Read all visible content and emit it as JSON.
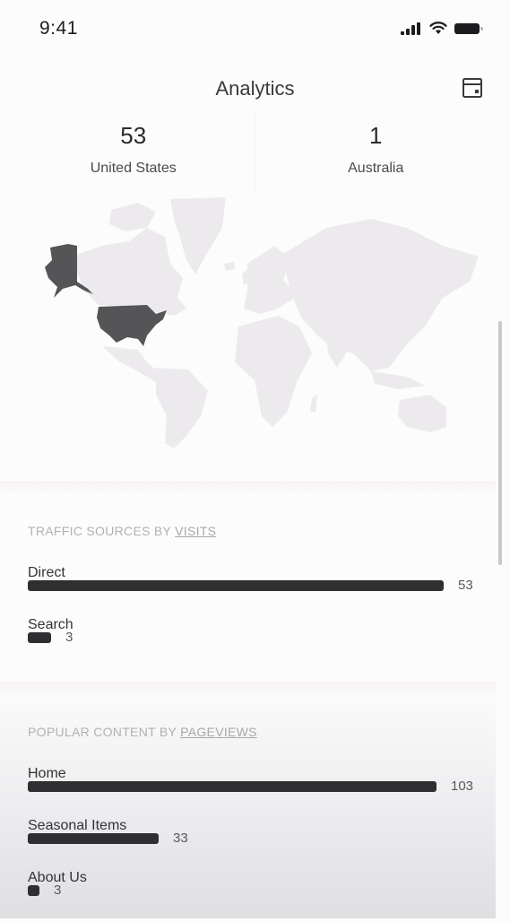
{
  "status_bar": {
    "time": "9:41",
    "icons": [
      "signal-icon",
      "wifi-icon",
      "battery-icon"
    ]
  },
  "header": {
    "title": "Analytics",
    "action_icon": "calendar-icon"
  },
  "stats": [
    {
      "value": "53",
      "label": "United States"
    },
    {
      "value": "1",
      "label": "Australia"
    }
  ],
  "map": {
    "highlighted_regions": [
      "United States",
      "Alaska"
    ],
    "highlight_color": "#555457",
    "base_color": "#eceaed"
  },
  "traffic_sources": {
    "title_prefix": "TRAFFIC SOURCES BY ",
    "title_link": "VISITS",
    "items": [
      {
        "label": "Direct",
        "value": 53
      },
      {
        "label": "Search",
        "value": 3
      }
    ]
  },
  "popular_content": {
    "title_prefix": "POPULAR CONTENT BY ",
    "title_link": "PAGEVIEWS",
    "items": [
      {
        "label": "Home",
        "value": 103
      },
      {
        "label": "Seasonal Items",
        "value": 33
      },
      {
        "label": "About Us",
        "value": 3
      }
    ]
  },
  "chart_data": [
    {
      "type": "bar",
      "title": "Traffic Sources by Visits",
      "categories": [
        "Direct",
        "Search"
      ],
      "values": [
        53,
        3
      ],
      "orientation": "horizontal"
    },
    {
      "type": "bar",
      "title": "Popular Content by Pageviews",
      "categories": [
        "Home",
        "Seasonal Items",
        "About Us"
      ],
      "values": [
        103,
        33,
        3
      ],
      "orientation": "horizontal"
    }
  ]
}
